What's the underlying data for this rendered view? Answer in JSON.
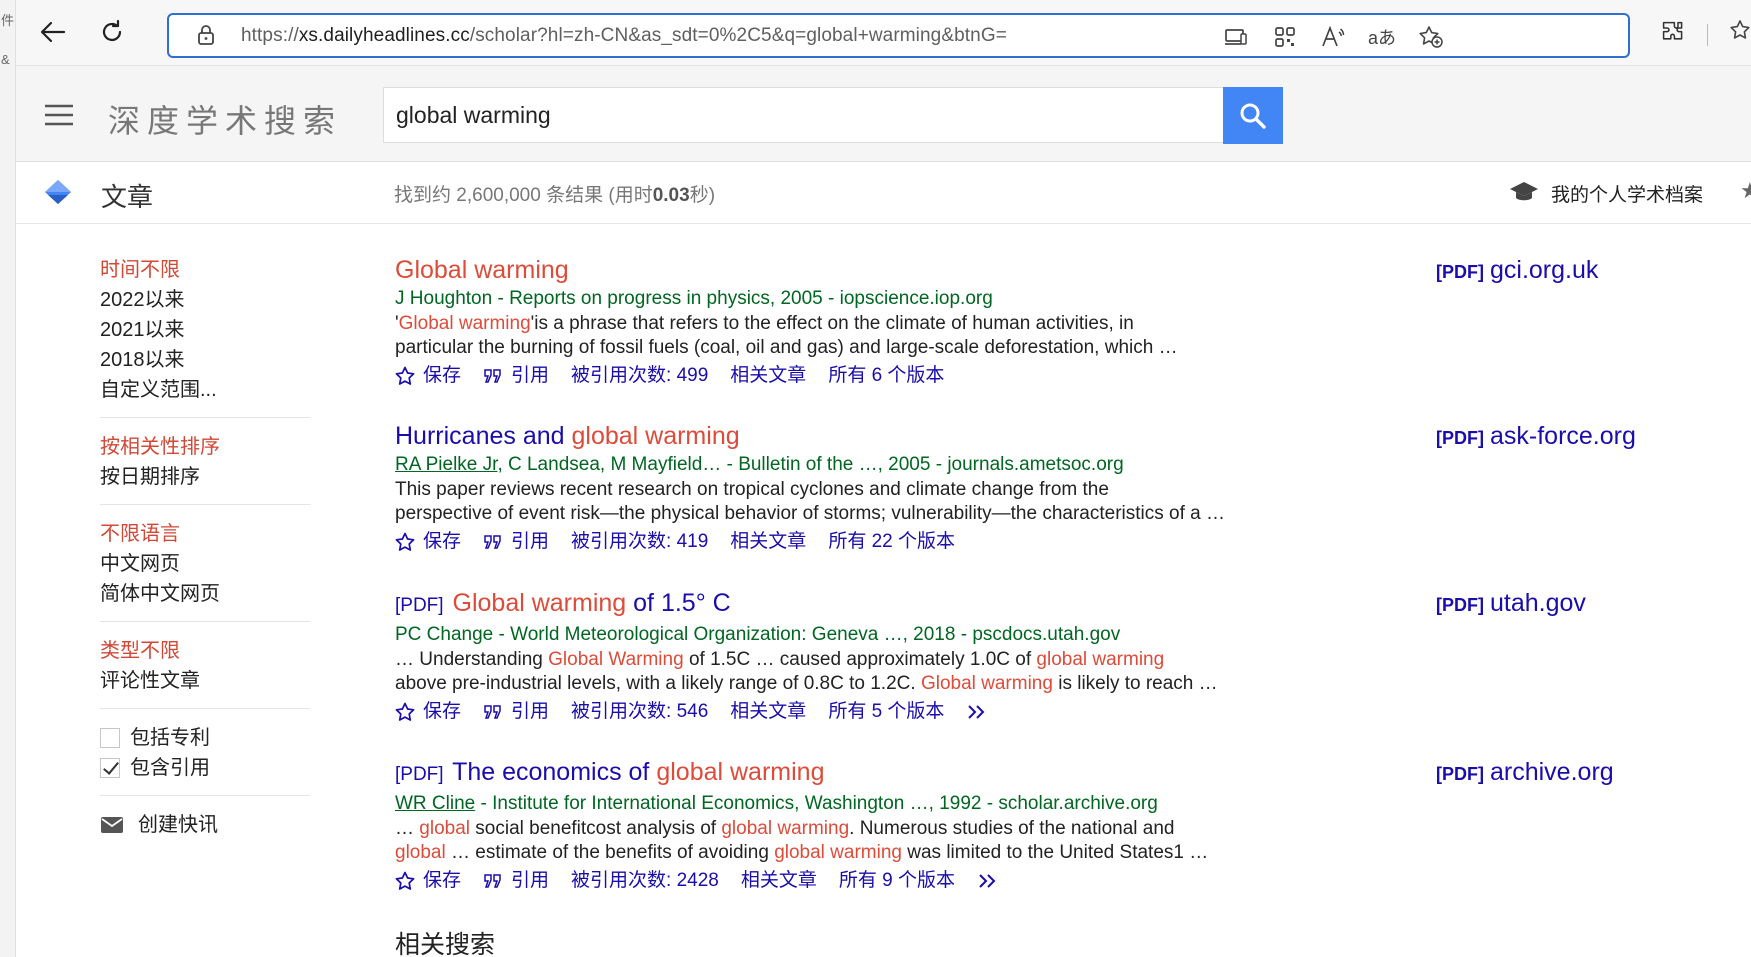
{
  "browser": {
    "url_prefix": "https://",
    "url_host": "xs.dailyheadlines.cc",
    "url_path": "/scholar?hl=zh-CN&as_sdt=0%2C5&q=global+warming&btnG=",
    "left_strip_chars": [
      "件",
      "&"
    ]
  },
  "header": {
    "brand": "深度学术搜索",
    "search_value": "global warming"
  },
  "subheader": {
    "section": "文章",
    "stats_prefix": "找到约 2,600,000 条结果  (用时",
    "stats_time": "0.03",
    "stats_suffix": "秒)",
    "profile": "我的个人学术档案"
  },
  "sidebar": {
    "time": [
      "时间不限",
      "2022以来",
      "2021以来",
      "2018以来",
      "自定义范围..."
    ],
    "sort": [
      "按相关性排序",
      "按日期排序"
    ],
    "lang": [
      "不限语言",
      "中文网页",
      "简体中文网页"
    ],
    "type": [
      "类型不限",
      "评论性文章"
    ],
    "include_patents": "包括专利",
    "include_citations": "包含引用",
    "create_alert": "创建快讯"
  },
  "results": [
    {
      "title": "Global warming",
      "authors": "J Houghton",
      "venue": " - Reports on progress in physics, 2005 - iopscience.iop.org",
      "snip1_a": "'",
      "snip1_hl": "Global warming",
      "snip1_b": "'is a phrase that refers to the effect on the climate of human activities, in",
      "snip2": "particular the burning of fossil fuels (coal, oil and gas) and large-scale deforestation, which …",
      "save": "保存",
      "cite": "引用",
      "cited_by": "被引用次数: 499",
      "related": "相关文章",
      "versions": "所有 6 个版本",
      "side_tag": "[PDF]",
      "side_host": "gci.org.uk"
    },
    {
      "title_a": "Hurricanes and ",
      "title_hl": "global warming",
      "authors_link": "RA Pielke Jr",
      "authors_rest": ", C Landsea, M Mayfield… - Bulletin of the …, 2005 - journals.ametsoc.org",
      "snip1": "This paper reviews recent research on tropical cyclones and climate change from the",
      "snip2": "perspective of event risk—the physical behavior of storms; vulnerability—the characteristics of a …",
      "save": "保存",
      "cite": "引用",
      "cited_by": "被引用次数: 419",
      "related": "相关文章",
      "versions": "所有 22 个版本",
      "side_tag": "[PDF]",
      "side_host": "ask-force.org"
    },
    {
      "pdf": "[PDF]",
      "title_hl": "Global warming",
      "title_b": " of 1.5° C",
      "authors": "PC Change - World Meteorological Organization: Geneva …, 2018 - pscdocs.utah.gov",
      "s1a": "… Understanding ",
      "s1h1": "Global Warming",
      "s1b": " of 1.5C … caused approximately 1.0C of ",
      "s1h2": "global warming",
      "s2a": "above pre-industrial levels, with a likely range of 0.8C to 1.2C. ",
      "s2h": "Global warming",
      "s2b": " is likely to reach …",
      "save": "保存",
      "cite": "引用",
      "cited_by": "被引用次数: 546",
      "related": "相关文章",
      "versions": "所有 5 个版本",
      "side_tag": "[PDF]",
      "side_host": "utah.gov"
    },
    {
      "pdf": "[PDF]",
      "title_a": "The economics of ",
      "title_hl": "global warming",
      "authors_link": "WR Cline",
      "authors_rest": " - Institute for International Economics, Washington …, 1992 - scholar.archive.org",
      "s1a": "… ",
      "s1h1": "global",
      "s1b": " social benefitcost analysis of ",
      "s1h2": "global warming",
      "s1c": ". Numerous studies of the national and",
      "s2h1": "global",
      "s2a": " … estimate of the benefits of avoiding ",
      "s2h2": "global warming",
      "s2b": " was limited to the United States1 …",
      "save": "保存",
      "cite": "引用",
      "cited_by": "被引用次数: 2428",
      "related": "相关文章",
      "versions": "所有 9 个版本",
      "side_tag": "[PDF]",
      "side_host": "archive.org"
    }
  ],
  "related_searches": "相关搜索"
}
